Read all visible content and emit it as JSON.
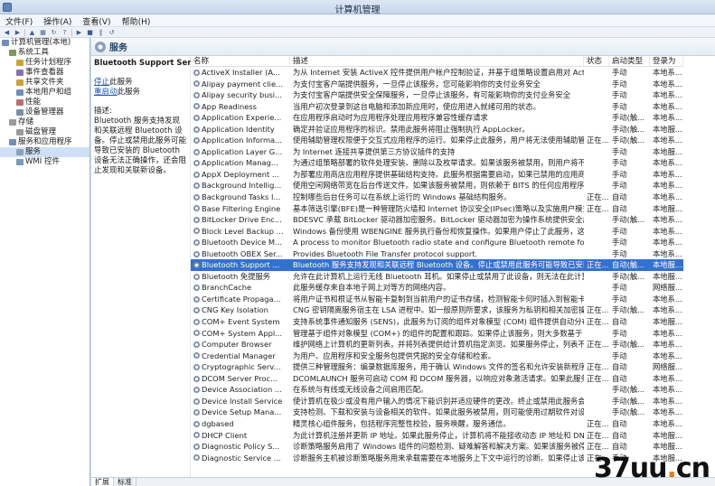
{
  "window": {
    "title": "计算机管理"
  },
  "menu": [
    "文件(F)",
    "操作(A)",
    "查看(V)",
    "帮助(H)"
  ],
  "toolbar": [
    "back-icon",
    "forward-icon",
    "up-icon",
    "properties-icon",
    "refresh-icon",
    "help-icon",
    "play-icon",
    "stop-icon",
    "pause-icon",
    "restart-icon"
  ],
  "tree": [
    {
      "label": "计算机管理(本地)",
      "indent": 0
    },
    {
      "label": "系统工具",
      "indent": 1
    },
    {
      "label": "任务计划程序",
      "indent": 2
    },
    {
      "label": "事件查看器",
      "indent": 2
    },
    {
      "label": "共享文件夹",
      "indent": 2
    },
    {
      "label": "本地用户和组",
      "indent": 2
    },
    {
      "label": "性能",
      "indent": 2
    },
    {
      "label": "设备管理器",
      "indent": 2
    },
    {
      "label": "存储",
      "indent": 1
    },
    {
      "label": "磁盘管理",
      "indent": 2
    },
    {
      "label": "服务和应用程序",
      "indent": 1
    },
    {
      "label": "服务",
      "indent": 2,
      "selected": true
    },
    {
      "label": "WMI 控件",
      "indent": 2
    }
  ],
  "panel": {
    "title": "服务"
  },
  "desc": {
    "service_name": "Bluetooth Support Service",
    "stop_link": "停止",
    "stop_suffix": "此服务",
    "restart_link": "重启动",
    "restart_suffix": "此服务",
    "label": "描述:",
    "text": "Bluetooth 服务支持发现和关联远程 Bluetooth 设备。停止或禁用此服务可能导致已安装的 Bluetooth 设备无法正确操作，还会阻止发现和关联新设备。"
  },
  "columns": [
    "名称",
    "描述",
    "状态",
    "启动类型",
    "登录为"
  ],
  "rows": [
    [
      "ActiveX Installer (A...",
      "为从 Internet 安装 ActiveX 控件提供用户帐户控制验证，并基于组策略设置启用对 ActiveX ...",
      "",
      "手动",
      "本地系..."
    ],
    [
      "Alipay payment clie...",
      "为支付宝客户端提供服务，一旦停止该服务，您可能影响你的支付业务安全",
      "",
      "手动",
      "本地系..."
    ],
    [
      "Alipay security busi...",
      "为支付宝客户端提供安全保障服务，一旦停止该服务，有可能影响你的支付业务安全",
      "",
      "手动",
      "本地系..."
    ],
    [
      "App Readiness",
      "当用户初次登录到这台电脑和添加新应用时，使应用进入就绪可用的状态。",
      "",
      "手动",
      "本地系..."
    ],
    [
      "Application Experie...",
      "在应用程序启动时为应用程序处理应用程序兼容性缓存请求",
      "",
      "手动(触...",
      "本地系..."
    ],
    [
      "Application Identity",
      "确定并验证应用程序的标识。禁用此服务将阻止强制执行 AppLocker。",
      "",
      "手动(触...",
      "本地服..."
    ],
    [
      "Application Informa...",
      "使用辅助管理权限便于交互式应用程序的运行。如果停止此服务，用户将无法使用辅助管理权...",
      "正在...",
      "手动(触...",
      "本地系..."
    ],
    [
      "Application Layer G...",
      "为 Internet 连接共享提供第三方协议插件的支持",
      "",
      "手动",
      "本地服..."
    ],
    [
      "Application Manag...",
      "为通过组策略部署的软件处理安装、删除以及枚举请求。如果该服务被禁用，则用户将不能安...",
      "",
      "手动",
      "本地系..."
    ],
    [
      "AppX Deployment ...",
      "为部署应用商店应用程序提供基础结构支持。此服务根据需要启动，如果已禁用的应用商店应...",
      "",
      "手动",
      "本地系..."
    ],
    [
      "Background Intellig...",
      "使用空闲网络带宽在后台传送文件。如果该服务被禁用，则依赖于 BITS 的任何应用程序(如 Wi...",
      "",
      "手动",
      "本地系..."
    ],
    [
      "Background Tasks I...",
      "控制哪些后台任务可以在系统上运行的 Windows 基础结构服务。",
      "正在...",
      "自动",
      "本地系..."
    ],
    [
      "Base Filtering Engine",
      "基本筛选引擎(BFE)是一种管理防火墙和 Internet 协议安全(IPsec)策略以及实施用户模式筛选...",
      "正在...",
      "自动",
      "本地服..."
    ],
    [
      "BitLocker Drive Enc...",
      "BDESVC 承载 BitLocker 驱动器加密服务。BitLocker 驱动器加密为操作系统提供安全启动保...",
      "",
      "手动(触...",
      "本地系..."
    ],
    [
      "Block Level Backup ...",
      "Windows 备份使用 WBENGINE 服务执行备份和恢复操作。如果用户停止了此服务，这可能会...",
      "",
      "手动",
      "本地系..."
    ],
    [
      "Bluetooth Device M...",
      "A process to monitor Bluetooth radio state and configure Bluetooth remote folders.",
      "",
      "手动",
      "本地系..."
    ],
    [
      "Bluetooth OBEX Ser...",
      "Provides Bluetooth File Transfer protocol support.",
      "",
      "手动",
      "本地系..."
    ],
    [
      "Bluetooth Support ...",
      "Bluetooth 服务支持发现和关联远程 Bluetooth 设备。停止或禁用此服务可能导致已安装的 Bl...",
      "正在...",
      "自动(触...",
      "本地服..."
    ],
    [
      "Bluetooth 免提服务",
      "允许在此计算机上运行无线 Bluetooth 耳机。如果停止或禁用了此设备，则无法在此计算机上...",
      "",
      "手动(触...",
      "本地服..."
    ],
    [
      "BranchCache",
      "此服务缓存来自本地子网上对等方的网络内容。",
      "",
      "手动",
      "网络服..."
    ],
    [
      "Certificate Propaga...",
      "将用户证书和根证书从智能卡复制到当前用户的证书存储，检测智能卡何时插入到智能卡读卡...",
      "",
      "手动",
      "本地系..."
    ],
    [
      "CNG Key Isolation",
      "CNG 密钥隔离服务宿主在 LSA 进程中。如一般原则所要求，该服务为私钥和相关加密操作提...",
      "正在...",
      "手动(触...",
      "本地系..."
    ],
    [
      "COM+ Event System",
      "支持系统事件通知服务 (SENS)，此服务为订阅的组件对象模型 (COM) 组件提供自动分布事件...",
      "正在...",
      "自动",
      "本地服..."
    ],
    [
      "COM+ System Appl...",
      "管理基于组件对象模型 (COM+) 的组件的配置和跟踪。如果停止该服务，则大多数基于 COM...",
      "",
      "手动",
      "本地系..."
    ],
    [
      "Computer Browser",
      "维护网络上计算机的更新列表，并将列表提供给计算机指定浏览。如果服务停止，列表不会被...",
      "正在...",
      "手动(触...",
      "本地系..."
    ],
    [
      "Credential Manager",
      "为用户、应用程序和安全服务包提供凭据的安全存储和检索。",
      "",
      "手动",
      "本地系..."
    ],
    [
      "Cryptographic Serv...",
      "提供三种管理服务：编录数据库服务，用于确认 Windows 文件的签名和允许安装新程序；受保...",
      "正在...",
      "自动",
      "网络服..."
    ],
    [
      "DCOM Server Proc...",
      "DCOMLAUNCH 服务可启动 COM 和 DCOM 服务器，以响应对象激活请求。如果此服务被停...",
      "正在...",
      "自动",
      "本地系..."
    ],
    [
      "Device Association ...",
      "在系统与有线或无线设备之间启用匹配。",
      "",
      "手动(触...",
      "本地系..."
    ],
    [
      "Device Install Service",
      "使计算机在极少或没有用户输入的情况下能识别并适应硬件的更改。终止或禁用此服务会造成...",
      "",
      "手动(触...",
      "本地系..."
    ],
    [
      "Device Setup Mana...",
      "支持检测、下载和安装与设备相关的软件。如果此服务被禁用，则可能使用过期软件对设备进...",
      "",
      "手动(触...",
      "本地系..."
    ],
    [
      "dgbased",
      "精灵核心组件服务，包括程序完整性校验，服务唤醒，服务通信。",
      "正在...",
      "自动",
      "本地系..."
    ],
    [
      "DHCP Client",
      "为此计算机注册并更新 IP 地址。如果此服务停止，计算机将不能接收动态 IP 地址和 DNS 更新...",
      "正在...",
      "自动",
      "本地服..."
    ],
    [
      "Diagnostic Policy S...",
      "诊断策略服务启用了 Windows 组件的问题检测、疑难解答和解决方案。如果该服务被停止，诊...",
      "正在...",
      "自动",
      "本地服..."
    ],
    [
      "Diagnostic Service ...",
      "诊断服务主机被诊断策略服务用来承载需要在本地服务上下文中运行的诊断。如果停止该服...",
      "正在...",
      "手动",
      "本地服..."
    ]
  ],
  "tabs": [
    "扩展",
    "标准"
  ],
  "watermark": {
    "text": "37uu",
    "dot": ".",
    "tld": "cn",
    "sub": "08.net"
  }
}
